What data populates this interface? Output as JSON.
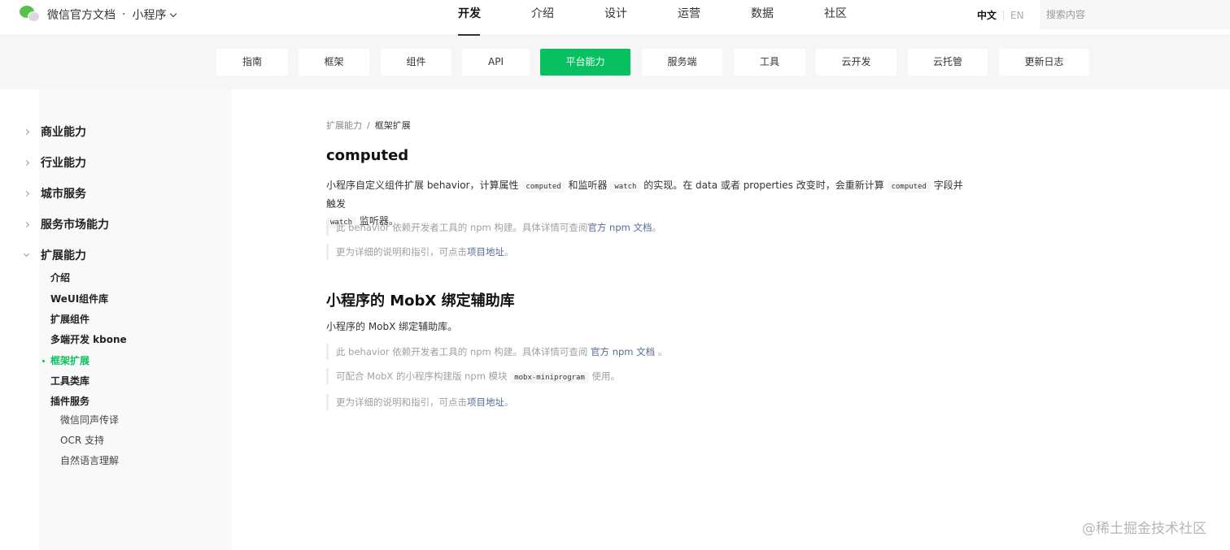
{
  "header": {
    "brand_title": "微信官方文档",
    "brand_dot": "·",
    "brand_sub": "小程序",
    "nav": [
      "开发",
      "介绍",
      "设计",
      "运营",
      "数据",
      "社区"
    ],
    "active_nav": "开发",
    "lang_current": "中文",
    "lang_alt": "EN",
    "search_placeholder": "搜索内容"
  },
  "subnav": {
    "tabs": [
      "指南",
      "框架",
      "组件",
      "API",
      "平台能力",
      "服务端",
      "工具",
      "云开发",
      "云托管",
      "更新日志"
    ],
    "active": "平台能力"
  },
  "sidebar": {
    "groups": [
      "商业能力",
      "行业能力",
      "城市服务",
      "服务市场能力",
      "扩展能力"
    ],
    "expanded": "扩展能力",
    "children": [
      "介绍",
      "WeUI组件库",
      "扩展组件",
      "多端开发 kbone",
      "框架扩展",
      "工具类库",
      "插件服务"
    ],
    "active_child": "框架扩展",
    "plugin_children": [
      "微信同声传译",
      "OCR 支持",
      "自然语言理解"
    ]
  },
  "content": {
    "breadcrumb": [
      "扩展能力",
      "/",
      "框架扩展"
    ],
    "section1": {
      "title": "computed",
      "para_line1_a": "小程序自定义组件扩展 behavior，计算属性 ",
      "code_computed": "computed",
      "para_line1_b": " 和监听器 ",
      "code_watch": "watch",
      "para_line1_c": " 的实现。在 data 或者 properties 改变时，会重新计算 ",
      "para_line1_d": " 字段并触发",
      "para_line2": " 监听器。",
      "note1_text": "此 behavior 依赖开发者工具的 npm 构建。具体详情可查阅",
      "note1_link": "官方 npm 文档",
      "note1_end": "。",
      "note2_text": "更为详细的说明和指引，可点击",
      "note2_link": "项目地址",
      "note2_end": "。"
    },
    "section2": {
      "title": "小程序的 MobX 绑定辅助库",
      "para": "小程序的 MobX 绑定辅助库。",
      "note1_text": "此 behavior 依赖开发者工具的 npm 构建。具体详情可查阅 ",
      "note1_link": "官方 npm 文档",
      "note1_end": " 。",
      "note2_text": "可配合 MobX 的小程序构建版 npm 模块 ",
      "note2_code": "mobx-miniprogram",
      "note2_end": " 使用。",
      "note3_text": "更为详细的说明和指引，可点击",
      "note3_link": "项目地址",
      "note3_end": "。"
    }
  },
  "watermark": "@稀土掘金技术社区",
  "colors": {
    "accent": "#07c160",
    "link": "#576b95",
    "subnav_bg": "#f6f6f6",
    "sidebar_bg": "#f9f9f9"
  }
}
